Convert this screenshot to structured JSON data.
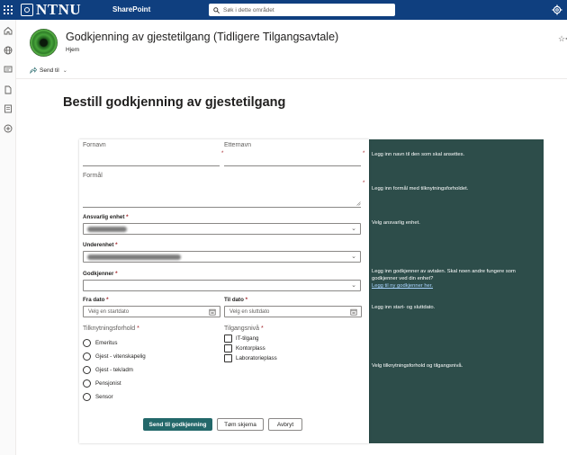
{
  "suitebar": {
    "brand": "NTNU",
    "app_name": "SharePoint",
    "search_placeholder": "Søk i dette området",
    "color": "#0f3f7f"
  },
  "site": {
    "title": "Godkjenning av gjestetilgang (Tidligere Tilgangsavtale)",
    "nav_home": "Hjem",
    "favorite_glyph": "☆<"
  },
  "commands": {
    "send_to": "Send til"
  },
  "page": {
    "title": "Bestill godkjenning av gjestetilgang"
  },
  "form": {
    "fornavn_label": "Fornavn",
    "etternavn_label": "Etternavn",
    "formaal_label": "Formål",
    "ansvarlig_label": "Ansvarlig enhet",
    "underenhet_label": "Underenhet",
    "godkjenner_label": "Godkjenner",
    "fra_dato_label": "Fra dato",
    "til_dato_label": "Til dato",
    "fra_dato_placeholder": "Velg en startdato",
    "til_dato_placeholder": "Velg en sluttdato",
    "tilknytning_label": "Tilknytningsforhold",
    "tilgang_label": "Tilgangsnivå",
    "tilknytning_options": [
      "Emeritus",
      "Gjest - vitenskapelig",
      "Gjest - tek/adm",
      "Pensjonist",
      "Sensor"
    ],
    "tilgang_options": [
      "IT-tilgang",
      "Kontorplass",
      "Laboratorieplass"
    ],
    "required_marker": "*"
  },
  "help": {
    "navn": "Legg inn navn til den som skal ansettes.",
    "formaal": "Legg inn formål med tilknytningsforholdet.",
    "enhet": "Velg ansvarlig enhet.",
    "godkjenner": "Legg inn godkjenner av avtalen. Skal noen andre fungere som godkjenner ved din enhet?",
    "godkjenner_link": "Legg til ny godkjenner her.",
    "dato": "Legg inn start- og sluttdato.",
    "tilknytning": "Velg tilknytningsforhold og tilgangsnivå.",
    "panel_color": "#2d4d4a"
  },
  "buttons": {
    "submit": "Send til godkjenning",
    "clear": "Tøm skjema",
    "cancel": "Avbryt"
  }
}
